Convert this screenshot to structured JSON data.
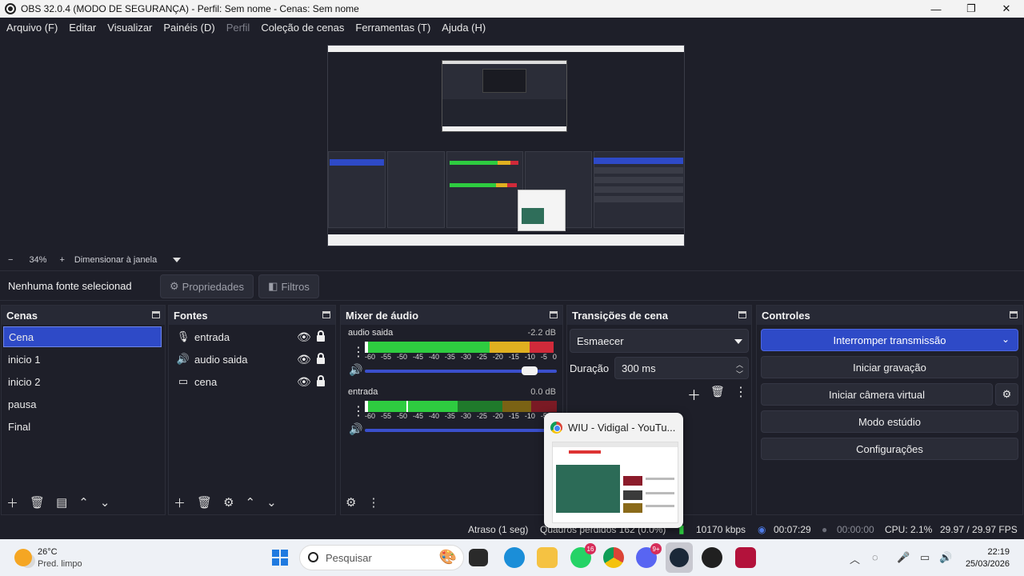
{
  "window": {
    "title": "OBS 32.0.4 (MODO DE SEGURANÇA) - Perfil: Sem nome - Cenas: Sem nome",
    "minimize": "—",
    "maximize": "❐",
    "close": "✕"
  },
  "menu": [
    {
      "label": "Arquivo (F)",
      "enabled": true
    },
    {
      "label": "Editar",
      "enabled": true
    },
    {
      "label": "Visualizar",
      "enabled": true
    },
    {
      "label": "Painéis (D)",
      "enabled": true
    },
    {
      "label": "Perfil",
      "enabled": false
    },
    {
      "label": "Coleção de cenas",
      "enabled": true
    },
    {
      "label": "Ferramentas (T)",
      "enabled": true
    },
    {
      "label": "Ajuda (H)",
      "enabled": true
    }
  ],
  "zoom": {
    "minus": "−",
    "value": "34%",
    "plus": "+",
    "fit_label": "Dimensionar à janela"
  },
  "context": {
    "no_source": "Nenhuma fonte selecionad",
    "properties": "Propriedades",
    "filters": "Filtros"
  },
  "scenes": {
    "title": "Cenas",
    "items": [
      "Cena",
      "inicio 1",
      "inicio 2",
      "pausa",
      "Final"
    ],
    "selected_index": 0
  },
  "sources": {
    "title": "Fontes",
    "items": [
      {
        "label": "entrada",
        "icon": "microphone-icon"
      },
      {
        "label": "audio saida",
        "icon": "speaker-icon"
      },
      {
        "label": "cena",
        "icon": "display-icon"
      }
    ]
  },
  "mixer": {
    "title": "Mixer de áudio",
    "scale": [
      "-60",
      "-55",
      "-50",
      "-45",
      "-40",
      "-35",
      "-30",
      "-25",
      "-20",
      "-15",
      "-10",
      "-5",
      "0"
    ],
    "tracks": [
      {
        "name": "audio saida",
        "db": "-2.2 dB",
        "volume": 0.86
      },
      {
        "name": "entrada",
        "db": "0.0 dB",
        "volume": 1.0
      }
    ]
  },
  "transitions": {
    "title": "Transições de cena",
    "selected": "Esmaecer",
    "duration_label": "Duração",
    "duration_value": "300 ms"
  },
  "controls": {
    "title": "Controles",
    "stop_stream": "Interromper transmissão",
    "start_recording": "Iniciar gravação",
    "start_virtual_cam": "Iniciar câmera virtual",
    "studio_mode": "Modo estúdio",
    "settings": "Configurações"
  },
  "status": {
    "delay": "Atraso (1 seg)",
    "dropped": "Quadros perdidos 162 (0.0%)",
    "bitrate": "10170 kbps",
    "stream_time": "00:07:29",
    "rec_time": "00:00:00",
    "cpu": "CPU: 2.1%",
    "fps": "29.97 / 29.97 FPS"
  },
  "popup": {
    "title": "WIU - Vidigal - YouTu..."
  },
  "taskbar": {
    "temp": "26°C",
    "weather": "Pred. limpo",
    "search_placeholder": "Pesquisar",
    "time": "22:19",
    "date": "25/03/2026",
    "whatsapp_badge": "16",
    "discord_badge": "9+"
  },
  "colors": {
    "accent": "#2e4ac7",
    "background": "#1e1f29",
    "meter_green": "#2ecc40",
    "meter_yellow": "#e0b020",
    "meter_red": "#d02a3a"
  }
}
